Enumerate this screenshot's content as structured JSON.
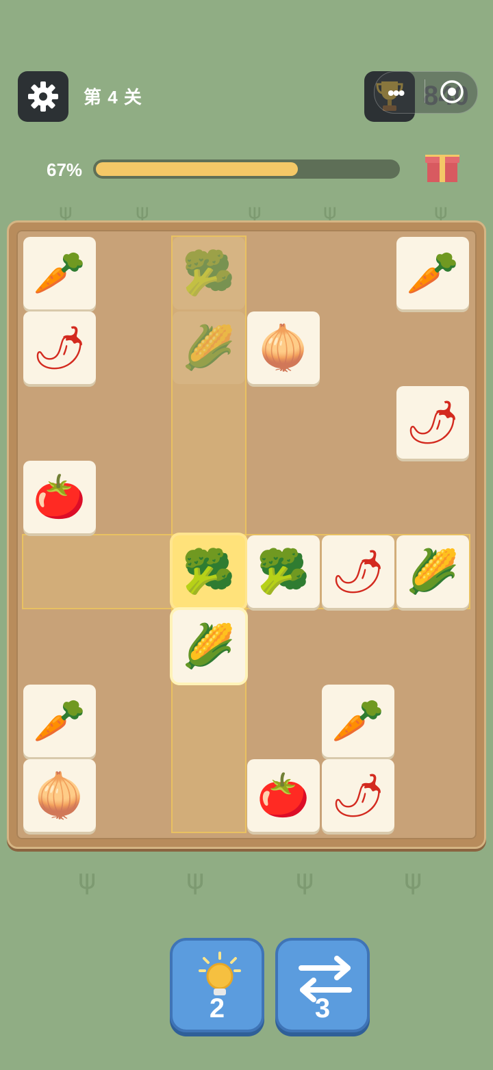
{
  "header": {
    "level_label": "第 4 关",
    "score": "840",
    "settings_icon": "gear-icon",
    "trophy_icon": "trophy-icon",
    "more_icon": "more-dots-icon",
    "target_icon": "target-icon"
  },
  "progress": {
    "percent_label": "67%",
    "value": 0.67,
    "gift_icon": "gift-icon"
  },
  "board": {
    "rows": 8,
    "cols": 6,
    "tiles": [
      {
        "row": 0,
        "col": 0,
        "item": "carrot",
        "glyph": "🥕",
        "state": "normal"
      },
      {
        "row": 0,
        "col": 2,
        "item": "broccoli",
        "glyph": "🥦",
        "state": "ghost"
      },
      {
        "row": 0,
        "col": 5,
        "item": "carrot",
        "glyph": "🥕",
        "state": "normal"
      },
      {
        "row": 1,
        "col": 0,
        "item": "chili",
        "glyph": "🌶",
        "state": "normal"
      },
      {
        "row": 1,
        "col": 2,
        "item": "corn",
        "glyph": "🌽",
        "state": "ghost"
      },
      {
        "row": 1,
        "col": 3,
        "item": "onion",
        "glyph": "🧅",
        "state": "normal"
      },
      {
        "row": 2,
        "col": 5,
        "item": "chili",
        "glyph": "🌶",
        "state": "normal"
      },
      {
        "row": 3,
        "col": 0,
        "item": "tomato",
        "glyph": "🍅",
        "state": "normal"
      },
      {
        "row": 4,
        "col": 2,
        "item": "broccoli",
        "glyph": "🥦",
        "state": "selected"
      },
      {
        "row": 4,
        "col": 3,
        "item": "broccoli",
        "glyph": "🥦",
        "state": "normal"
      },
      {
        "row": 4,
        "col": 4,
        "item": "chili",
        "glyph": "🌶",
        "state": "normal"
      },
      {
        "row": 4,
        "col": 5,
        "item": "corn",
        "glyph": "🌽",
        "state": "normal"
      },
      {
        "row": 5,
        "col": 2,
        "item": "corn",
        "glyph": "🌽",
        "state": "glow"
      },
      {
        "row": 6,
        "col": 0,
        "item": "carrot",
        "glyph": "🥕",
        "state": "normal"
      },
      {
        "row": 6,
        "col": 4,
        "item": "carrot",
        "glyph": "🥕",
        "state": "normal"
      },
      {
        "row": 7,
        "col": 0,
        "item": "onion",
        "glyph": "🧅",
        "state": "normal"
      },
      {
        "row": 7,
        "col": 3,
        "item": "tomato",
        "glyph": "🍅",
        "state": "normal"
      },
      {
        "row": 7,
        "col": 4,
        "item": "chili",
        "glyph": "🌶",
        "state": "normal"
      }
    ],
    "selected_row": 4,
    "selected_col": 2
  },
  "tools": {
    "hint": {
      "icon": "lightbulb-icon",
      "count": "2"
    },
    "shuffle": {
      "icon": "swap-arrows-icon",
      "count": "3"
    }
  },
  "colors": {
    "background": "#90ad84",
    "board": "#c8a278",
    "progress_fill": "#f4c867",
    "button_blue": "#5b9cde"
  }
}
